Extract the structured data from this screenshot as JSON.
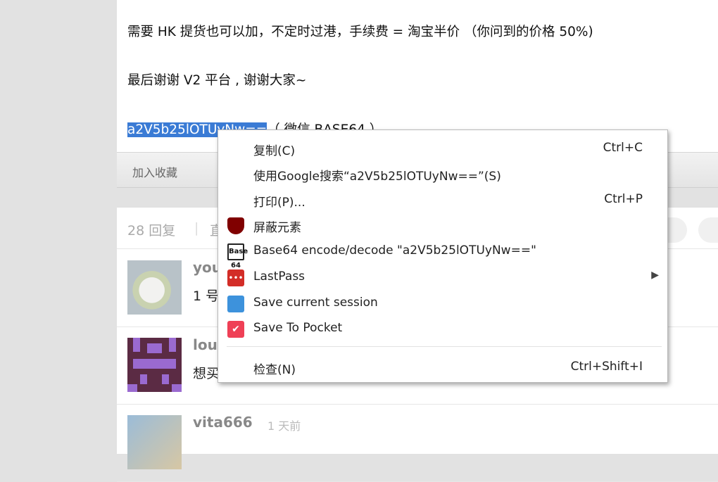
{
  "post": {
    "line1": "需要 HK 提货也可以加，不定时过港，手续费 = 淘宝半价 （你问到的价格 50%)",
    "line2": "最后谢谢 V2 平台 , 谢谢大家~",
    "selected_text": "a2V5b25lOTUyNw==",
    "suffix": "（ 微信 BASE64 ）"
  },
  "action_bar": {
    "favorite": "加入收藏"
  },
  "replies_header": {
    "count": "28 回复",
    "separator": "|",
    "next": "直"
  },
  "replies": [
    {
      "user": "you",
      "time": "",
      "text": "1 号"
    },
    {
      "user": "lou",
      "time": "",
      "text": "想买"
    },
    {
      "user": "vita666",
      "time": "1 天前",
      "text": ""
    }
  ],
  "context_menu": {
    "items": [
      {
        "label": "复制(C)",
        "shortcut": "Ctrl+C",
        "icon": ""
      },
      {
        "label": "使用Google搜索“a2V5b25lOTUyNw==”(S)",
        "shortcut": "",
        "icon": ""
      },
      {
        "label": "打印(P)...",
        "shortcut": "Ctrl+P",
        "icon": ""
      },
      {
        "label": "屏蔽元素",
        "shortcut": "",
        "icon": "ublock-icon"
      },
      {
        "label": "Base64 encode/decode \"a2V5b25lOTUyNw==\"",
        "shortcut": "",
        "icon": "base64-icon"
      },
      {
        "label": "LastPass",
        "shortcut": "",
        "icon": "lastpass-icon",
        "submenu": true
      },
      {
        "label": "Save current session",
        "shortcut": "",
        "icon": "session-icon"
      },
      {
        "label": "Save To Pocket",
        "shortcut": "",
        "icon": "pocket-icon"
      },
      {
        "label": "检查(N)",
        "shortcut": "Ctrl+Shift+I",
        "icon": ""
      }
    ],
    "base64_icon_text": "Base 64",
    "lastpass_icon_text": "•••",
    "pocket_icon_text": "✔",
    "submenu_arrow": "▶"
  }
}
